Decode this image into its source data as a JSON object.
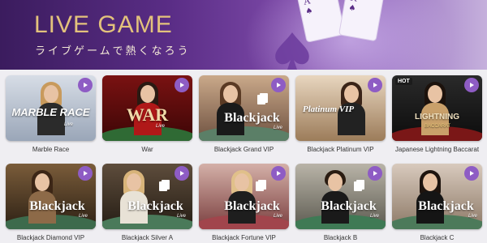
{
  "banner": {
    "title": "LIVE GAME",
    "subtitle": "ライブゲームで熱くなろう"
  },
  "colors": {
    "accent": "#8e5cc4",
    "title_gold": "#e3c27c"
  },
  "games": [
    {
      "name": "Marble Race",
      "logo": "MARBLE RACE",
      "live": "Live",
      "hot": ""
    },
    {
      "name": "War",
      "logo": "WAR",
      "live": "Live",
      "hot": ""
    },
    {
      "name": "Blackjack Grand VIP",
      "logo": "Blackjack",
      "live": "Live",
      "hot": ""
    },
    {
      "name": "Blackjack Platinum VIP",
      "logo": "Platinum VIP",
      "live": "",
      "hot": ""
    },
    {
      "name": "Japanese Lightning Baccarat",
      "logo": "LIGHTNING",
      "live": "BACCARAT",
      "hot": "HOT"
    },
    {
      "name": "Blackjack Diamond VIP",
      "logo": "Blackjack",
      "live": "Live",
      "hot": ""
    },
    {
      "name": "Blackjack Silver A",
      "logo": "Blackjack",
      "live": "Live",
      "hot": ""
    },
    {
      "name": "Blackjack Fortune VIP",
      "logo": "Blackjack",
      "live": "Live",
      "hot": ""
    },
    {
      "name": "Blackjack B",
      "logo": "Blackjack",
      "live": "Live",
      "hot": ""
    },
    {
      "name": "Blackjack C",
      "logo": "Blackjack",
      "live": "Live",
      "hot": ""
    }
  ]
}
